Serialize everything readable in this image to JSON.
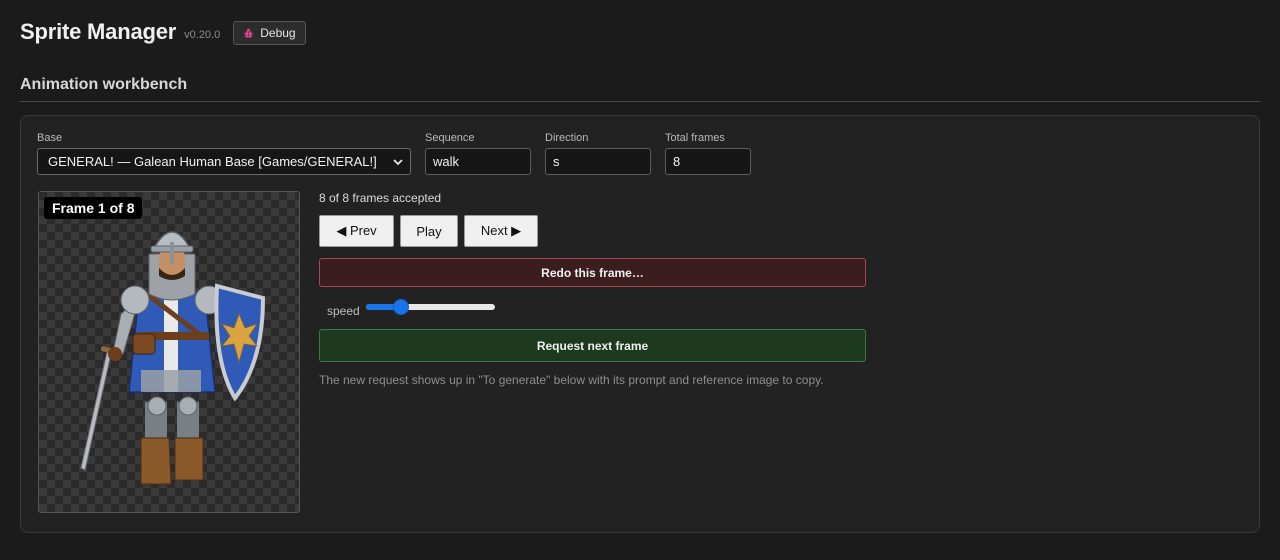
{
  "header": {
    "title": "Sprite Manager",
    "version": "v0.20.0",
    "debug_label": "Debug",
    "debug_icon": "bug-icon"
  },
  "workbench": {
    "title": "Animation workbench",
    "base": {
      "label": "Base",
      "selected": "GENERAL! — Galean Human Base [Games/GENERAL!]"
    },
    "sequence": {
      "label": "Sequence",
      "value": "walk"
    },
    "direction": {
      "label": "Direction",
      "value": "s"
    },
    "total_frames": {
      "label": "Total frames",
      "value": "8"
    },
    "preview": {
      "frame_badge": "Frame 1 of 8"
    },
    "status": "8 of 8 frames accepted",
    "controls": {
      "prev_label": "◀ Prev",
      "play_label": "Play",
      "next_label": "Next ▶",
      "redo_label": "Redo this frame…",
      "speed_label": "speed",
      "speed_value": 0.26,
      "request_label": "Request next frame",
      "hint": "The new request shows up in \"To generate\" below with its prompt and reference image to copy."
    }
  }
}
